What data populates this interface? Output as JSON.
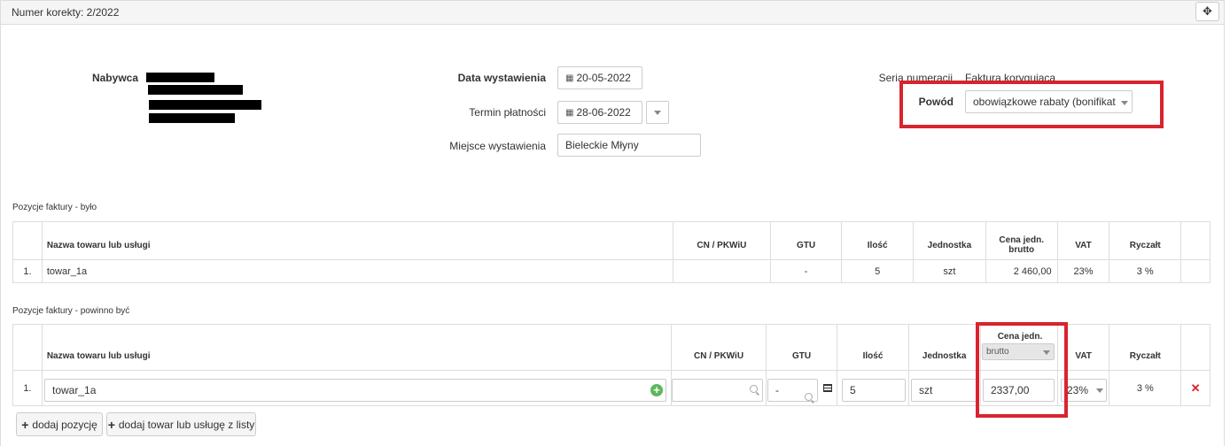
{
  "panel": {
    "title": "Numer korekty: 2/2022",
    "move_icon": "move-icon"
  },
  "buyer": {
    "label": "Nabywca"
  },
  "dates": {
    "issue_label": "Data wystawienia",
    "issue_value": "20-05-2022",
    "due_label": "Termin płatności",
    "due_value": "28-06-2022",
    "place_label": "Miejsce wystawienia",
    "place_value": "Bieleckie Młyny"
  },
  "series": {
    "label": "Seria numeracji",
    "value": "Faktura korygująca"
  },
  "reason": {
    "label": "Powód",
    "value": "obowiązkowe rabaty (bonifikaty, up"
  },
  "before": {
    "title": "Pozycje faktury - było",
    "headers": {
      "name": "Nazwa towaru lub usługi",
      "cn": "CN / PKWiU",
      "gtu": "GTU",
      "qty": "Ilość",
      "unit": "Jednostka",
      "price": "Cena jedn. brutto",
      "vat": "VAT",
      "flat": "Ryczałt"
    },
    "rows": [
      {
        "no": "1.",
        "name": "towar_1a",
        "cn": "",
        "gtu": "-",
        "qty": "5",
        "unit": "szt",
        "price": "2 460,00",
        "vat": "23%",
        "flat": "3 %"
      }
    ]
  },
  "after": {
    "title": "Pozycje faktury - powinno być",
    "headers": {
      "name": "Nazwa towaru lub usługi",
      "cn": "CN / PKWiU",
      "gtu": "GTU",
      "qty": "Ilość",
      "unit": "Jednostka",
      "price": "Cena jedn.",
      "price_mode": "brutto",
      "vat": "VAT",
      "flat": "Ryczałt"
    },
    "rows": [
      {
        "no": "1.",
        "name": "towar_1a",
        "cn": "",
        "gtu": "-",
        "qty": "5",
        "unit": "szt",
        "price": "2337,00",
        "vat": "23%",
        "flat": "3 %"
      }
    ]
  },
  "buttons": {
    "add_position": "dodaj pozycję",
    "add_from_list": "dodaj towar lub usługę z listy"
  },
  "colors": {
    "highlight": "#d9232e",
    "add_green": "#5cb85c"
  }
}
